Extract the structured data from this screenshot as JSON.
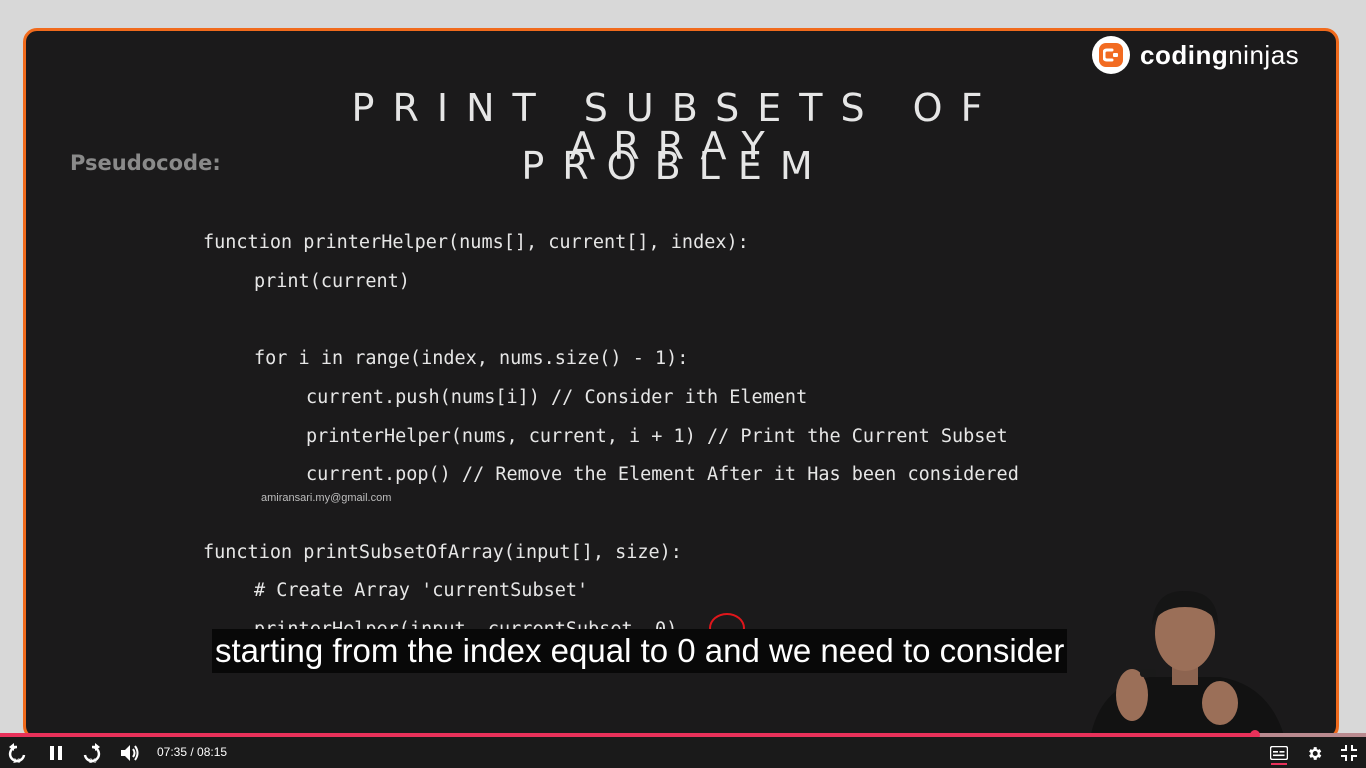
{
  "logo": {
    "brand_bold": "coding",
    "brand_light": "ninjas",
    "icon": "coding-ninjas-logo"
  },
  "slide": {
    "title_line1": "PRINT SUBSETS OF ARRAY",
    "title_line2": "PROBLEM",
    "section_label": "Pseudocode:",
    "code_lines": [
      "function printerHelper(nums[], current[], index):",
      "print(current)",
      "for i in range(index, nums.size() - 1):",
      "current.push(nums[i]) // Consider ith Element",
      "printerHelper(nums, current, i + 1) // Print the Current Subset",
      "current.pop() // Remove the Element After it Has been considered",
      "function printSubsetOfArray(input[], size):",
      "# Create Array 'currentSubset'",
      "printerHelper(input, currentSubset, 0)"
    ],
    "watermark_email": "amiransari.my@gmail.com",
    "annotation_color": "#e0161b"
  },
  "caption": {
    "text": "starting from the index equal to 0 and we need to consider"
  },
  "player": {
    "current_time": "07:35",
    "duration": "08:15",
    "time_display": "07:35 / 08:15",
    "progress": 0.919,
    "rewind_seconds": "20",
    "forward_seconds": "20",
    "accent_color": "#e8315a",
    "border_color": "#f06a1c",
    "icons": [
      "rewind-icon",
      "pause-icon",
      "forward-icon",
      "volume-icon",
      "subtitles-icon",
      "settings-icon",
      "exit-fullscreen-icon"
    ]
  }
}
